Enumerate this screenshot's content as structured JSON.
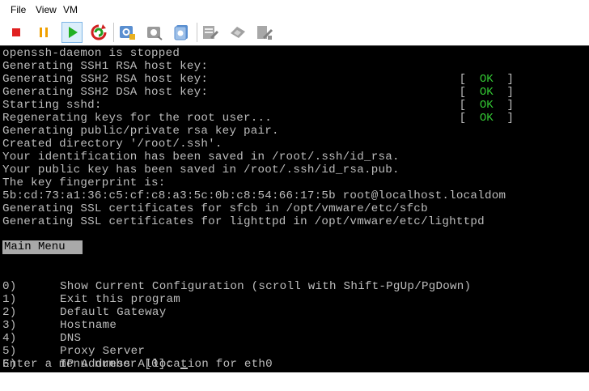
{
  "menubar": {
    "file": "File",
    "view": "View",
    "vm": "VM"
  },
  "toolbar": {
    "icons": [
      "stop-icon",
      "suspend-icon",
      "play-icon",
      "reset-icon",
      "snapshot-icon",
      "revert-snapshot-icon",
      "manage-snapshots-icon",
      "vm-settings-icon",
      "send-ctrl-alt-del-icon",
      "usb-devices-icon"
    ]
  },
  "console": {
    "lines": [
      "openssh-daemon is stopped",
      "Generating SSH1 RSA host key:",
      "Generating SSH2 RSA host key:",
      "Generating SSH2 DSA host key:",
      "Starting sshd:",
      "Regenerating keys for the root user...",
      "Generating public/private rsa key pair.",
      "Created directory '/root/.ssh'.",
      "Your identification has been saved in /root/.ssh/id_rsa.",
      "Your public key has been saved in /root/.ssh/id_rsa.pub.",
      "The key fingerprint is:",
      "5b:cd:73:a1:36:c5:cf:c8:a3:5c:0b:c8:54:66:17:5b root@localhost.localdom",
      "Generating SSL certificates for sfcb in /opt/vmware/etc/sfcb",
      "Generating SSL certificates for lighttpd in /opt/vmware/etc/lighttpd"
    ],
    "status_open": "[",
    "status_ok": "OK",
    "status_close": "]",
    "main_menu_title": "Main Menu",
    "menu_options": [
      {
        "num": "0)",
        "label": "Show Current Configuration (scroll with Shift-PgUp/PgDown)"
      },
      {
        "num": "1)",
        "label": "Exit this program"
      },
      {
        "num": "2)",
        "label": "Default Gateway"
      },
      {
        "num": "3)",
        "label": "Hostname"
      },
      {
        "num": "4)",
        "label": "DNS"
      },
      {
        "num": "5)",
        "label": "Proxy Server"
      },
      {
        "num": "6)",
        "label": "IP Address Allocation for eth0"
      }
    ],
    "prompt": "Enter a menu number [0]: "
  },
  "colors": {
    "console_bg": "#000000",
    "console_text": "#bdbdbd",
    "ok_green": "#33c633",
    "menu_bar_bg": "#a9a9a9"
  }
}
